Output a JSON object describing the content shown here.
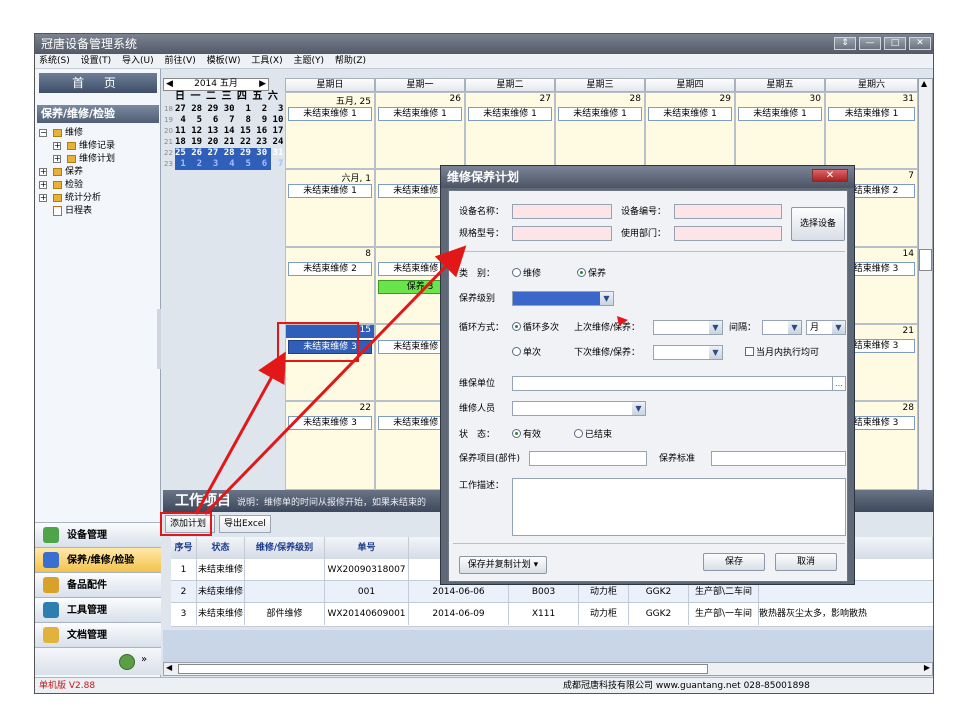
{
  "window": {
    "title": "冠唐设备管理系统",
    "buttons": [
      "⇕",
      "—",
      "□",
      "✕"
    ]
  },
  "menu": [
    "系统(S)",
    "设置(T)",
    "导入(U)",
    "前往(V)",
    "模板(W)",
    "工具(X)",
    "主题(Y)",
    "帮助(Z)"
  ],
  "sidebar": {
    "home": "首 页",
    "section": "保养/维修/检验",
    "tree": [
      {
        "label": "维修",
        "pm": "-",
        "level": 0
      },
      {
        "label": "维修记录",
        "pm": "+",
        "level": 1
      },
      {
        "label": "维修计划",
        "pm": "+",
        "level": 1
      },
      {
        "label": "保养",
        "pm": "+",
        "level": 0
      },
      {
        "label": "检验",
        "pm": "+",
        "level": 0
      },
      {
        "label": "统计分析",
        "pm": "+",
        "level": 0
      },
      {
        "label": "日程表",
        "pm": "",
        "level": 0
      }
    ],
    "modules": [
      "设备管理",
      "保养/维修/检验",
      "备品配件",
      "工具管理",
      "文档管理"
    ]
  },
  "minical": {
    "header": "2014 五月",
    "weekdays": "日 一 二 三 四 五 六",
    "rows": [
      "27 28 29 30  1  2  3",
      " 4  5  6  7  8  9 10",
      "11 12 13 14 15 16 17",
      "18 19 20 21 22 23 24",
      "25 26 27 28 29 30 31",
      " 1  2  3  4  5  6  7"
    ],
    "weeknums": [
      "18",
      "19",
      "20",
      "21",
      "22",
      "23"
    ]
  },
  "calendar": {
    "weekdays": [
      "星期日",
      "星期一",
      "星期二",
      "星期三",
      "星期四",
      "星期五",
      "星期六"
    ],
    "row1": [
      "五月, 25",
      "26",
      "27",
      "28",
      "29",
      "30",
      "31"
    ],
    "row2": [
      "六月, 1",
      "",
      "",
      "",
      "",
      "",
      "7"
    ],
    "row3": [
      "8",
      "",
      "",
      "",
      "",
      "",
      "14"
    ],
    "row4": [
      "15",
      "",
      "",
      "",
      "",
      "",
      "21"
    ],
    "row5": [
      "22",
      "",
      "",
      "",
      "",
      "",
      "28"
    ],
    "events": {
      "e1": "未结束维修 1",
      "e2": "未结束维修 2",
      "e3": "未结束维修 3",
      "green": "保养 3"
    }
  },
  "work": {
    "title": "工作项目",
    "note": "说明：维修单的时间从报修开始，如果未结束的",
    "add_button": "添加计划",
    "export_button": "导出Excel"
  },
  "table": {
    "headers": [
      "序号",
      "状态",
      "维修/保养级别",
      "单号"
    ],
    "rows": [
      [
        "1",
        "未结束维修",
        "",
        "WX20090318007",
        "",
        "",
        "",
        "",
        "",
        ""
      ],
      [
        "2",
        "未结束维修",
        "",
        "001",
        "2014-06-06",
        "B003",
        "动力柜",
        "GGK2",
        "生产部\\二车间",
        ""
      ],
      [
        "3",
        "未结束维修",
        "部件维修",
        "WX20140609001",
        "2014-06-09",
        "X111",
        "动力柜",
        "GGK2",
        "生产部\\一车间",
        "散热器灰尘太多，影响散热"
      ]
    ]
  },
  "status": {
    "version": "单机版 V2.88",
    "company": "成都冠唐科技有限公司 www.guantang.net 028-85001898"
  },
  "dialog": {
    "title": "维修保养计划",
    "close": "✕",
    "labels": {
      "device_name": "设备名称：",
      "device_code": "设备编号：",
      "model": "规格型号：",
      "dept": "使用部门：",
      "category": "类　别：",
      "level": "保养级别",
      "cycle": "循环方式：",
      "last": "上次维修/保养：",
      "interval": "间隔：",
      "next": "下次维修/保养：",
      "unit": "维保单位",
      "staff": "维修人员",
      "state": "状　态：",
      "item": "保养项目(部件)",
      "standard": "保养标准",
      "desc": "工作描述："
    },
    "options": {
      "repair": "维修",
      "maintain": "保养",
      "multi": "循环多次",
      "single": "单次",
      "valid": "有效",
      "ended": "已结束",
      "month_exec": "当月内执行均可",
      "month_unit": "月"
    },
    "buttons": {
      "select_device": "选择设备",
      "save_copy": "保存并复制计划 ▾",
      "save": "保存",
      "cancel": "取消"
    }
  },
  "colors": {
    "accent_red": "#e21818",
    "selected_blue": "#2f5fb8",
    "green_event": "#69e44a"
  }
}
